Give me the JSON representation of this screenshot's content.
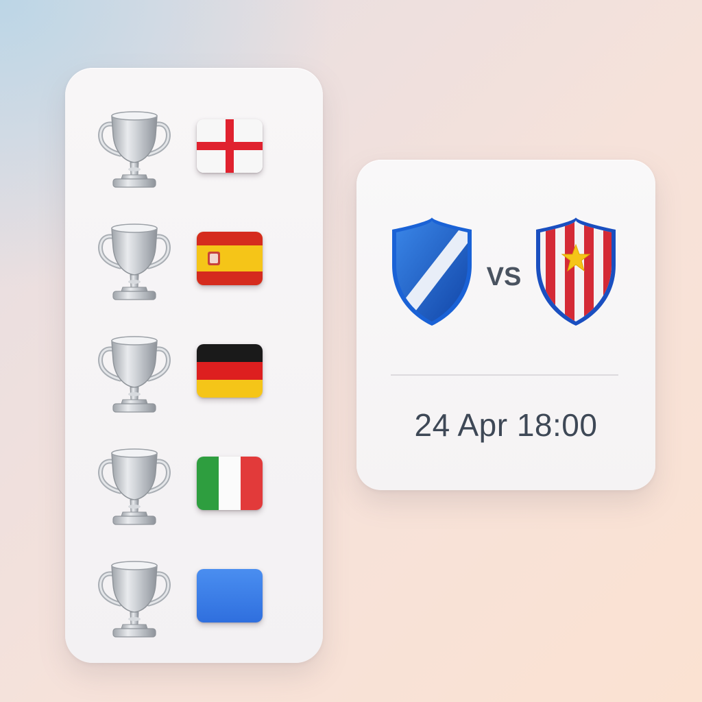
{
  "leagues": [
    {
      "trophy_icon": "trophy-icon",
      "flag": "england-flag",
      "colors": [
        "#ffffff",
        "#e0222f"
      ]
    },
    {
      "trophy_icon": "trophy-icon",
      "flag": "spain-flag",
      "colors": [
        "#d52b1e",
        "#f5c518"
      ]
    },
    {
      "trophy_icon": "trophy-icon",
      "flag": "germany-flag",
      "colors": [
        "#1a1a1a",
        "#dd1f1f",
        "#f5c518"
      ]
    },
    {
      "trophy_icon": "trophy-icon",
      "flag": "italy-flag",
      "colors": [
        "#2e9e3f",
        "#ffffff",
        "#e23a3a"
      ]
    },
    {
      "trophy_icon": "trophy-icon",
      "flag": "blue-flag",
      "colors": [
        "#3b7de8"
      ]
    }
  ],
  "match": {
    "home_crest_icon": "blue-white-diagonal-shield-icon",
    "away_crest_icon": "red-white-striped-star-shield-icon",
    "vs": "VS",
    "datetime": "24 Apr 18:00",
    "colors": {
      "home": "#1f5fc8",
      "away": "#d42a35",
      "star": "#f5c518"
    }
  }
}
